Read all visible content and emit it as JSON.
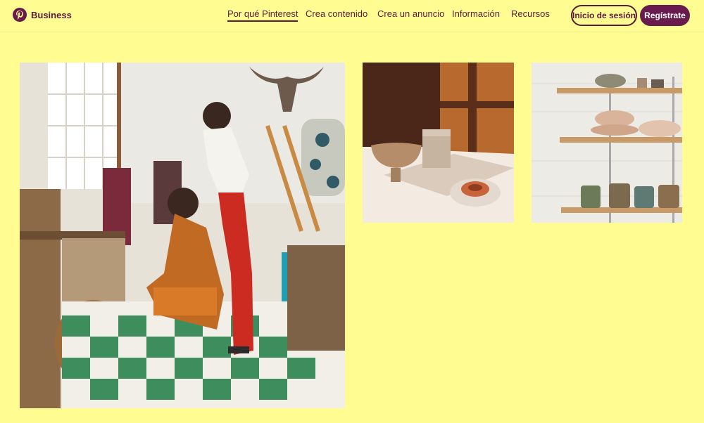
{
  "brand": {
    "name": "Business",
    "logo_icon": "pinterest-logo-icon",
    "accent": "#6a1b4d"
  },
  "nav": {
    "items": [
      {
        "label": "Por qué Pinterest",
        "active": true
      },
      {
        "label": "Crea contenido",
        "active": false
      },
      {
        "label": "Crea un anuncio",
        "active": false
      },
      {
        "label": "Información",
        "active": false
      },
      {
        "label": "Recursos",
        "active": false
      }
    ]
  },
  "actions": {
    "login_label": "Inicio de sesión",
    "signup_label": "Regístrate"
  },
  "colors": {
    "background": "#fffd92",
    "text": "#5b1a3a",
    "button_fill": "#6a1b4d"
  },
  "gallery": {
    "images": [
      {
        "subject": "shop-women-browsing-photo"
      },
      {
        "subject": "ceramic-bowls-photo"
      },
      {
        "subject": "pottery-shelves-photo"
      }
    ]
  }
}
